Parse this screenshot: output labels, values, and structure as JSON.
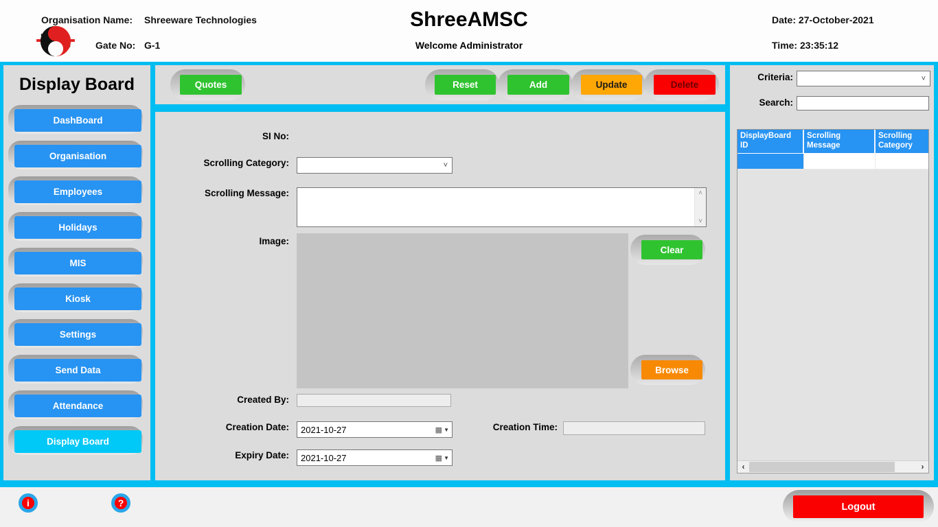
{
  "header": {
    "org_label": "Organisation Name:",
    "org_value": "Shreeware Technologies",
    "gate_label": "Gate No:",
    "gate_value": "G-1",
    "app_title": "ShreeAMSC",
    "welcome": "Welcome Administrator",
    "date_label": "Date:",
    "date_value": "27-October-2021",
    "time_label": "Time:",
    "time_value": "23:35:12"
  },
  "sidebar": {
    "title": "Display Board",
    "items": [
      {
        "label": "DashBoard",
        "active": false
      },
      {
        "label": "Organisation",
        "active": false
      },
      {
        "label": "Employees",
        "active": false
      },
      {
        "label": "Holidays",
        "active": false
      },
      {
        "label": "MIS",
        "active": false
      },
      {
        "label": "Kiosk",
        "active": false
      },
      {
        "label": "Settings",
        "active": false
      },
      {
        "label": "Send Data",
        "active": false
      },
      {
        "label": "Attendance",
        "active": false
      },
      {
        "label": "Display Board",
        "active": true
      }
    ]
  },
  "toolbar": {
    "quotes_label": "Quotes",
    "reset_label": "Reset",
    "add_label": "Add",
    "update_label": "Update",
    "delete_label": "Delete"
  },
  "form": {
    "si_no_label": "SI No:",
    "scrolling_category_label": "Scrolling Category:",
    "scrolling_category_value": "",
    "scrolling_message_label": "Scrolling Message:",
    "scrolling_message_value": "",
    "image_label": "Image:",
    "clear_label": "Clear",
    "browse_label": "Browse",
    "created_by_label": "Created By:",
    "created_by_value": "",
    "creation_date_label": "Creation Date:",
    "creation_date_value": "2021-10-27",
    "creation_time_label": "Creation Time:",
    "creation_time_value": "",
    "expiry_date_label": "Expiry Date:",
    "expiry_date_value": "2021-10-27"
  },
  "search_panel": {
    "criteria_label": "Criteria:",
    "criteria_value": "",
    "search_label": "Search:",
    "search_value": "",
    "grid": {
      "columns": [
        "DisplayBoard ID",
        "Scrolling Message",
        "Scrolling Category"
      ],
      "rows": [
        {
          "display_board_id": "",
          "scrolling_message": "",
          "scrolling_category": "",
          "selected": true
        }
      ]
    }
  },
  "footer": {
    "info_label": "i",
    "help_label": "?",
    "logout_label": "Logout"
  },
  "icons": {
    "logo": "yin-yang-logo",
    "combo_chevron": "chevron-down",
    "date_calendar": "calendar",
    "scroll_up": "chevron-up",
    "scroll_down": "chevron-down",
    "scroll_left": "chevron-left",
    "scroll_right": "chevron-right"
  },
  "colors": {
    "frame_cyan": "#00BDF2",
    "panel_gray": "#DCDCDC",
    "button_blue": "#2793F2",
    "active_item_cyan": "#00C8F7",
    "green": "#30C330",
    "update_orange": "#FFA705",
    "browse_orange": "#F78905",
    "red": "#FB0000",
    "grid_header_blue": "#2793F2",
    "picturebox_gray": "#C4C4C4"
  }
}
